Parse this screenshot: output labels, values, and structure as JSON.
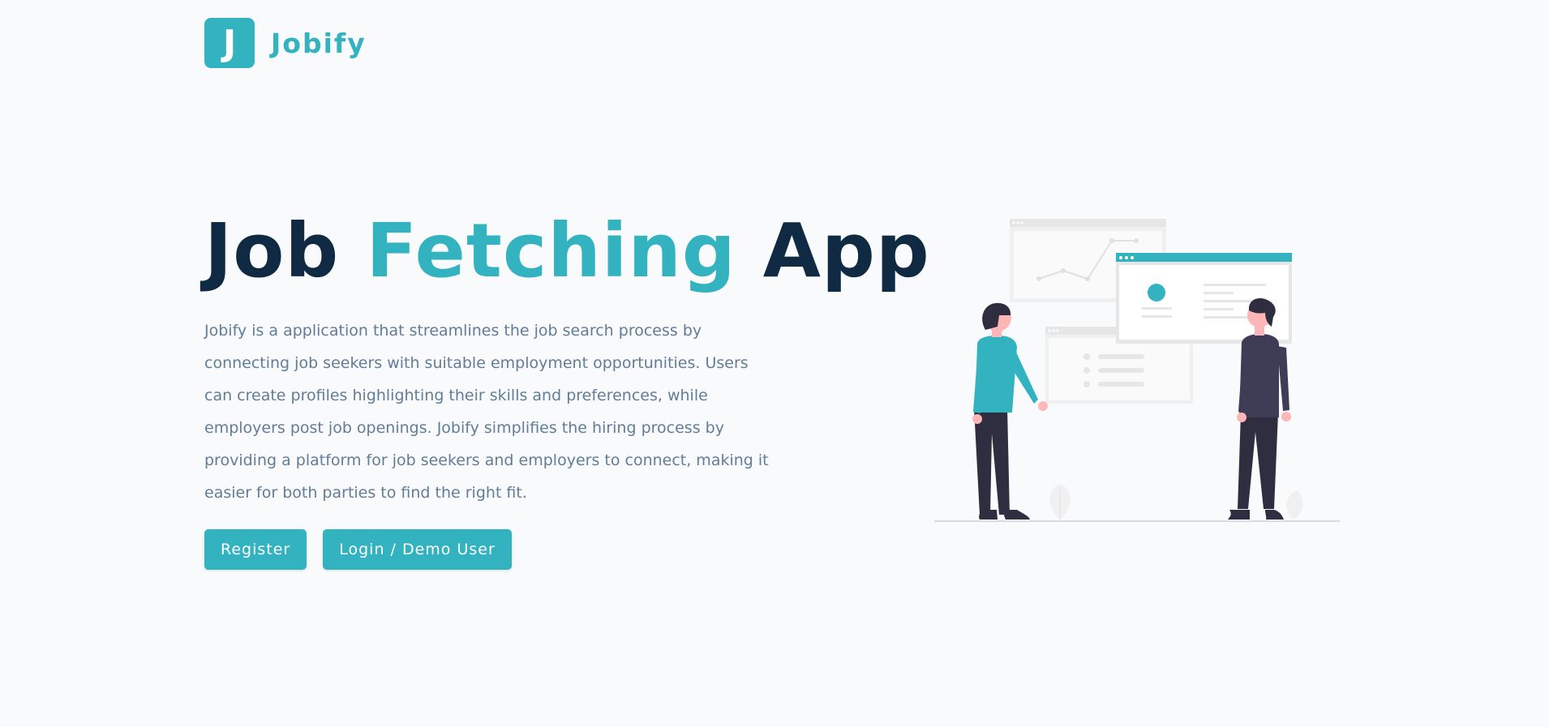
{
  "brand": {
    "logo_letter": "J",
    "name": "Jobify"
  },
  "hero": {
    "title_part1": "Job",
    "title_accent": "Fetching",
    "title_part2": "App",
    "description": "Jobify is a application that streamlines the job search process by connecting job seekers with suitable employment opportunities. Users can create profiles highlighting their skills and preferences, while employers post job openings. Jobify simplifies the hiring process by providing a platform for job seekers and employers to connect, making it easier for both parties to find the right fit."
  },
  "buttons": {
    "register": "Register",
    "login": "Login / Demo User"
  },
  "colors": {
    "primary": "#33b2c0",
    "heading": "#102a43",
    "text": "#627d98",
    "background": "#f8fafc"
  },
  "icons": {
    "logo": "letter-j-logo",
    "illustration": "people-with-dashboard-illustration"
  }
}
